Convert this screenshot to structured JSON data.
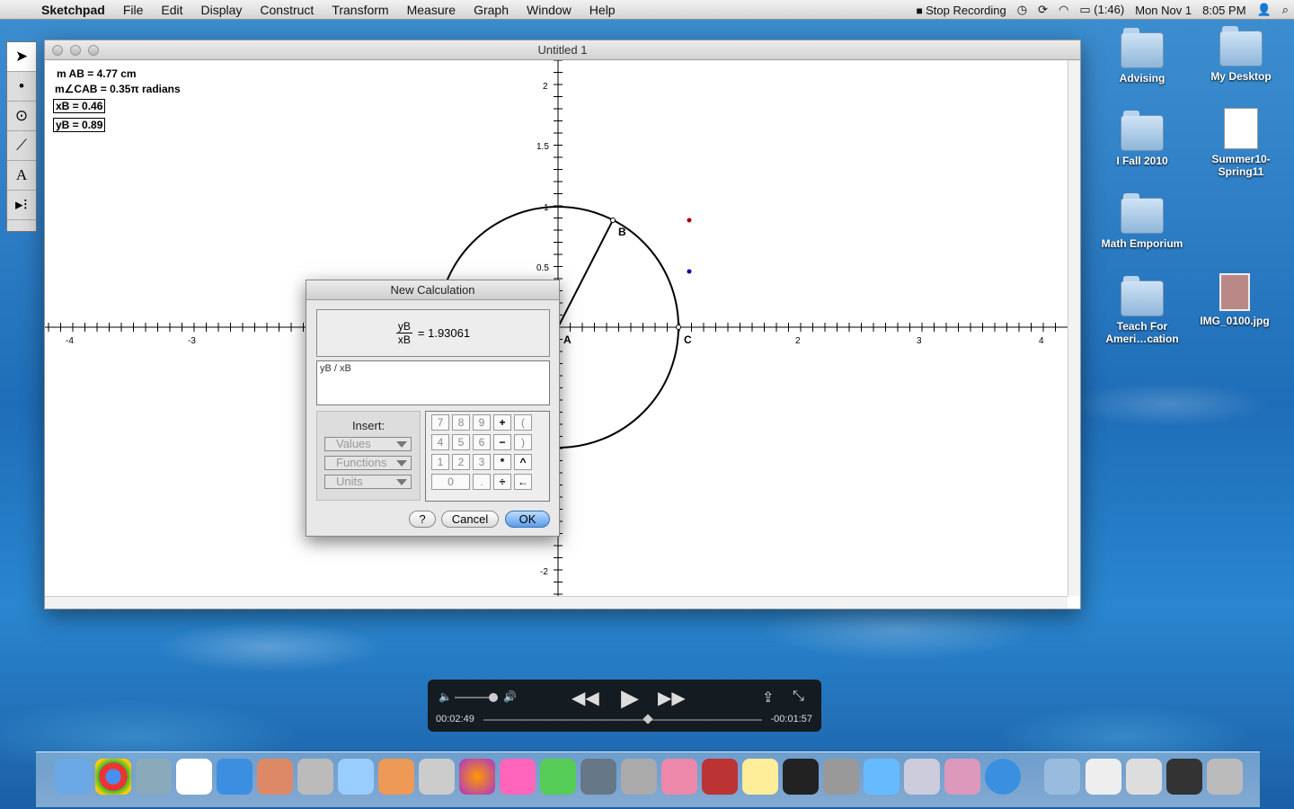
{
  "menubar": {
    "app_name": "Sketchpad",
    "items": [
      "File",
      "Edit",
      "Display",
      "Construct",
      "Transform",
      "Measure",
      "Graph",
      "Window",
      "Help"
    ],
    "status": {
      "recording": "Stop Recording",
      "battery": "(1:46)",
      "date": "Mon Nov 1",
      "time": "8:05 PM"
    }
  },
  "window": {
    "title": "Untitled 1"
  },
  "measurements": {
    "ab": "m AB = 4.77 cm",
    "angle": "m∠CAB = 0.35π radians",
    "xb": "xB = 0.46",
    "yb": "yB = 0.89"
  },
  "axes": {
    "x_ticks": [
      "-4",
      "-3",
      "2",
      "3",
      "4"
    ],
    "y_ticks": [
      "2",
      "1.5",
      "1",
      "0.5",
      "-2"
    ]
  },
  "points": {
    "a": "A",
    "b": "B",
    "c": "C"
  },
  "dialog": {
    "title": "New Calculation",
    "preview_num": "yB",
    "preview_den": "xB",
    "preview_result": "= 1.93061",
    "expression": "yB / xB",
    "insert_label": "Insert:",
    "values": "Values",
    "functions": "Functions",
    "units": "Units",
    "keys": [
      [
        "7",
        "8",
        "9",
        "+",
        "("
      ],
      [
        "4",
        "5",
        "6",
        "−",
        ")"
      ],
      [
        "1",
        "2",
        "3",
        "*",
        "^"
      ],
      [
        "0",
        ".",
        "÷",
        "←"
      ]
    ],
    "help": "?",
    "cancel": "Cancel",
    "ok": "OK"
  },
  "desktop": {
    "icons": [
      "Advising",
      "My Desktop",
      "I Fall 2010",
      "Summer10-Spring11",
      "Math Emporium",
      "Teach For Ameri…cation",
      "IMG_0100.jpg"
    ]
  },
  "player": {
    "elapsed": "00:02:49",
    "remaining": "-00:01:57",
    "progress": 0.59
  }
}
